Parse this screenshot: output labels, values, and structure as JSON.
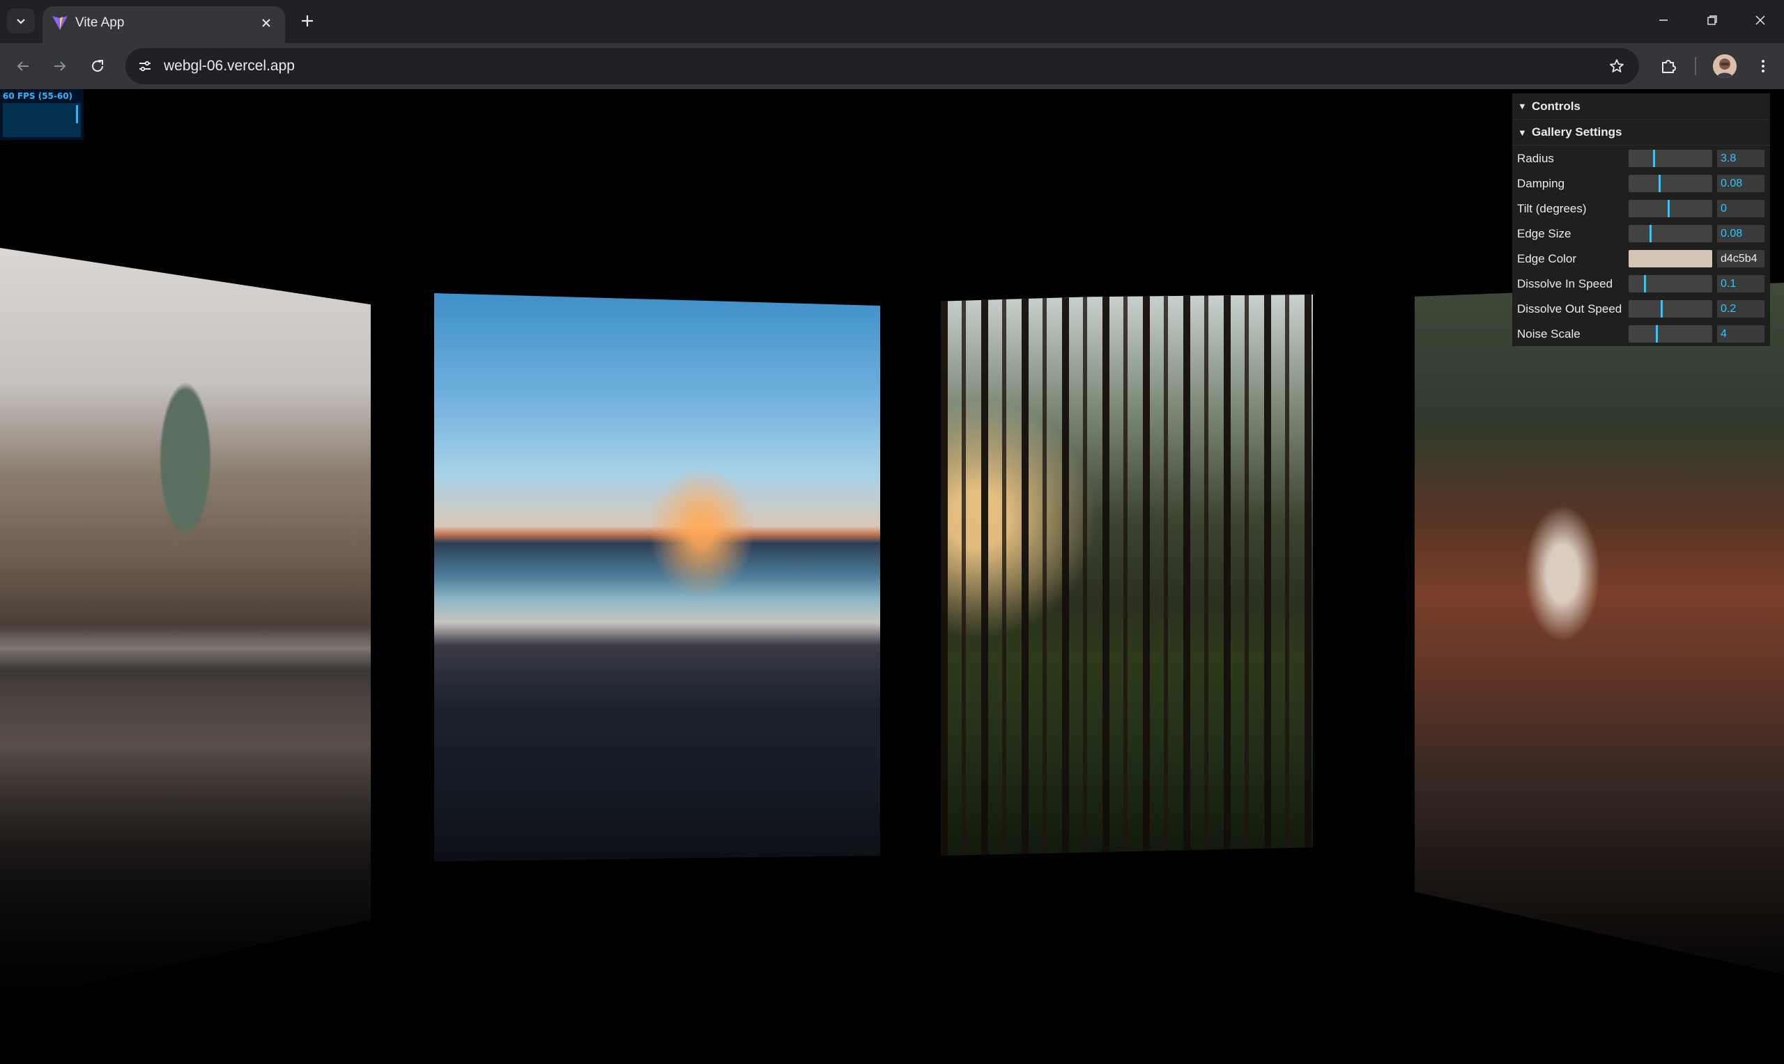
{
  "browser": {
    "tab_title": "Vite App",
    "url": "webgl-06.vercel.app"
  },
  "fps": {
    "text": "60 FPS (55-60)"
  },
  "controls": {
    "title": "Controls",
    "folder": "Gallery Settings",
    "rows": [
      {
        "label": "Radius",
        "value": "3.8",
        "level": 0.3
      },
      {
        "label": "Damping",
        "value": "0.08",
        "level": 0.37
      },
      {
        "label": "Tilt (degrees)",
        "value": "0",
        "level": 0.48
      },
      {
        "label": "Edge Size",
        "value": "0.08",
        "level": 0.26
      },
      {
        "label": "Edge Color",
        "value": "d4c5b4",
        "color": "#d4c5b4"
      },
      {
        "label": "Dissolve In Speed",
        "value": "0.1",
        "level": 0.19
      },
      {
        "label": "Dissolve Out Speed",
        "value": "0.2",
        "level": 0.39
      },
      {
        "label": "Noise Scale",
        "value": "4",
        "level": 0.33
      }
    ]
  },
  "gallery": {
    "images": [
      "church-reflection",
      "beach-sunset",
      "pine-forest",
      "waterfall"
    ]
  },
  "colors": {
    "accent": "#2cc9ff",
    "panel_bg": "#1f1f1f",
    "chrome_bg": "#202124",
    "toolbar_bg": "#35363a"
  }
}
